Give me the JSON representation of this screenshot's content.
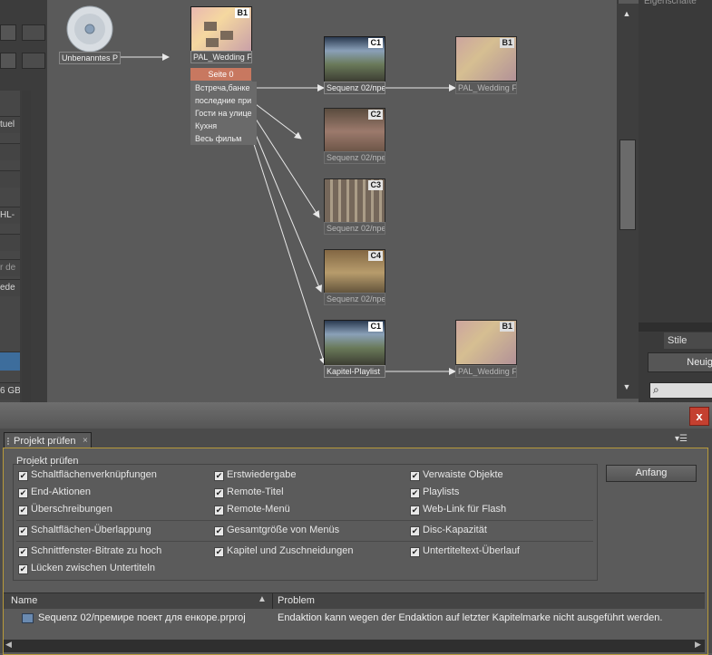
{
  "left_panel": {
    "fragments": [
      "tuel",
      "HL-",
      "r de",
      "ede",
      "6 GB"
    ]
  },
  "flow": {
    "source_node_label": "Unbenanntes P",
    "menu_node": {
      "label": "PAL_Wedding F",
      "badge": "B1",
      "page": "Seite 0",
      "items": [
        "Встреча,банке",
        "последние при",
        "Гости на улице",
        "Кухня",
        "Весь фильм"
      ]
    },
    "sequences": [
      {
        "label": "Sequenz 02/пре",
        "badge": "C1"
      },
      {
        "label": "Sequenz 02/пре",
        "badge": "C2"
      },
      {
        "label": "Sequenz 02/пре",
        "badge": "C3"
      },
      {
        "label": "Sequenz 02/пре",
        "badge": "C4"
      },
      {
        "label": "Kapitel-Playlist",
        "badge": "C1"
      }
    ],
    "targets": [
      {
        "label": "PAL_Wedding F",
        "badge": "B1"
      },
      {
        "label": "PAL_Wedding F",
        "badge": "B1"
      }
    ]
  },
  "right_panel": {
    "title_fragment": "Eigenschafte",
    "tab_stile": "Stile",
    "button_fragment": "Neuig"
  },
  "dialog": {
    "close": "x",
    "tab_label": "Projekt prüfen",
    "group_label": "Projekt prüfen",
    "start_button": "Anfang",
    "checks": [
      "Schaltflächenverknüpfungen",
      "Erstwiedergabe",
      "Verwaiste Objekte",
      "End-Aktionen",
      "Remote-Titel",
      "Playlists",
      "Überschreibungen",
      "Remote-Menü",
      "Web-Link für Flash",
      "Schaltflächen-Überlappung",
      "Gesamtgröße von Menüs",
      "Disc-Kapazität",
      "Schnittfenster-Bitrate zu hoch",
      "Kapitel und Zuschneidungen",
      "Untertiteltext-Überlauf",
      "Lücken zwischen Untertiteln"
    ],
    "table": {
      "col_name": "Name",
      "col_problem": "Problem",
      "row_name": "Sequenz 02/премире поект для енкоре.prproj",
      "row_problem": "Endaktion kann wegen der Endaktion auf letzter Kapitelmarke nicht ausgeführt werden."
    }
  },
  "colors": {
    "accent_border": "#b79a3a",
    "close_red": "#c44030"
  }
}
